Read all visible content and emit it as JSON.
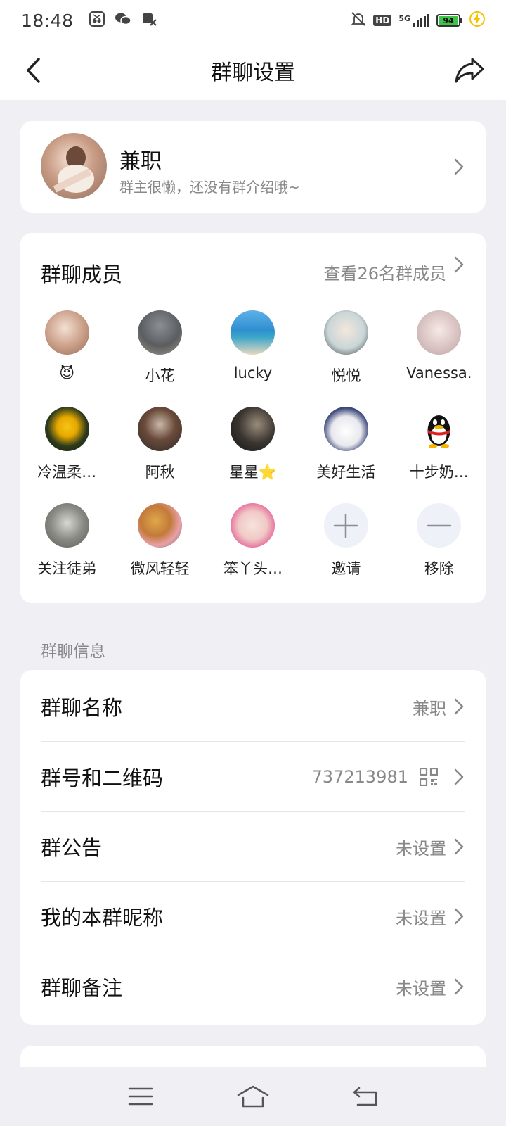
{
  "status": {
    "time": "18:48",
    "battery": "94",
    "network": "5G",
    "hd": "HD"
  },
  "nav": {
    "title": "群聊设置"
  },
  "group": {
    "name": "兼职",
    "description": "群主很懒，还没有群介绍哦~"
  },
  "members": {
    "title": "群聊成员",
    "view_all": "查看26名群成员",
    "list": [
      {
        "name": "😈"
      },
      {
        "name": "小花"
      },
      {
        "name": "lucky"
      },
      {
        "name": "悦悦"
      },
      {
        "name": "Vanessa."
      },
      {
        "name": "冷温柔…"
      },
      {
        "name": "阿秋"
      },
      {
        "name": "星星⭐"
      },
      {
        "name": "美好生活"
      },
      {
        "name": "十步奶…"
      },
      {
        "name": "关注徒弟"
      },
      {
        "name": "微风轻轻"
      },
      {
        "name": "笨丫头…"
      }
    ],
    "invite": "邀请",
    "remove": "移除"
  },
  "info": {
    "section_title": "群聊信息",
    "rows": [
      {
        "label": "群聊名称",
        "value": "兼职"
      },
      {
        "label": "群号和二维码",
        "value": "737213981"
      },
      {
        "label": "群公告",
        "value": "未设置"
      },
      {
        "label": "我的本群昵称",
        "value": "未设置"
      },
      {
        "label": "群聊备注",
        "value": "未设置"
      }
    ]
  },
  "colors": {
    "accent": "#3fc44a",
    "background": "#f0f0f4",
    "muted_text": "#888888"
  }
}
